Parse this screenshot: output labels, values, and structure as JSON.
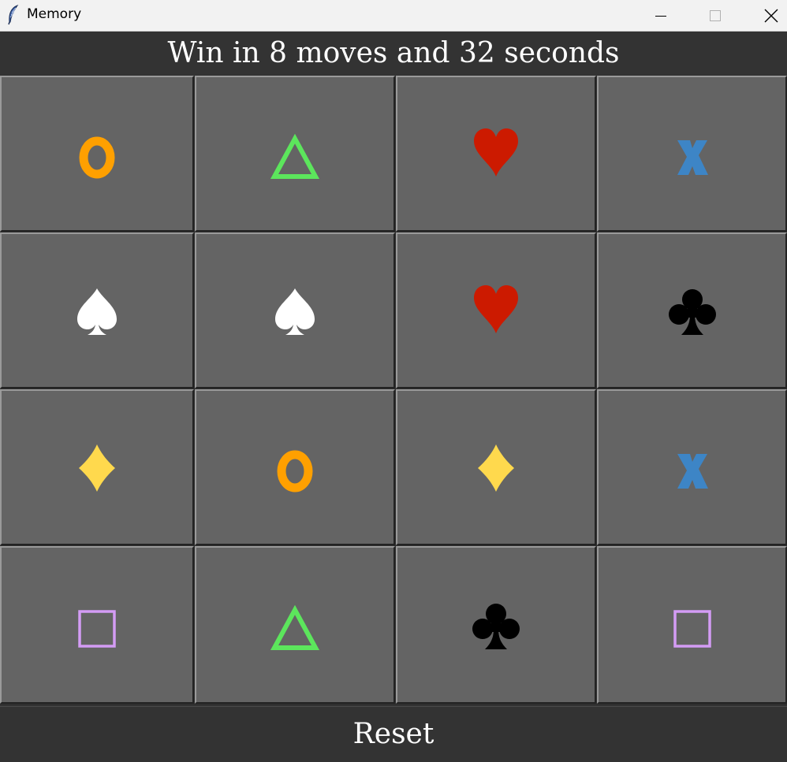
{
  "window": {
    "title": "Memory"
  },
  "status": {
    "text": "Win in 8 moves and 32 seconds"
  },
  "board": {
    "rows": 4,
    "cols": 4,
    "tiles": [
      {
        "symbol": "o",
        "color": "#ffa000"
      },
      {
        "symbol": "triangle",
        "color": "#5ce65c"
      },
      {
        "symbol": "heart",
        "color": "#cc1a00"
      },
      {
        "symbol": "x",
        "color": "#3d85c6"
      },
      {
        "symbol": "spade",
        "color": "#ffffff"
      },
      {
        "symbol": "spade",
        "color": "#ffffff"
      },
      {
        "symbol": "heart",
        "color": "#cc1a00"
      },
      {
        "symbol": "club",
        "color": "#000000"
      },
      {
        "symbol": "diamond",
        "color": "#ffd94d"
      },
      {
        "symbol": "o",
        "color": "#ffa000"
      },
      {
        "symbol": "diamond",
        "color": "#ffd94d"
      },
      {
        "symbol": "x",
        "color": "#3d85c6"
      },
      {
        "symbol": "square",
        "color": "#d49cf5"
      },
      {
        "symbol": "triangle",
        "color": "#5ce65c"
      },
      {
        "symbol": "club",
        "color": "#000000"
      },
      {
        "symbol": "square",
        "color": "#d49cf5"
      }
    ]
  },
  "reset": {
    "label": "Reset"
  }
}
